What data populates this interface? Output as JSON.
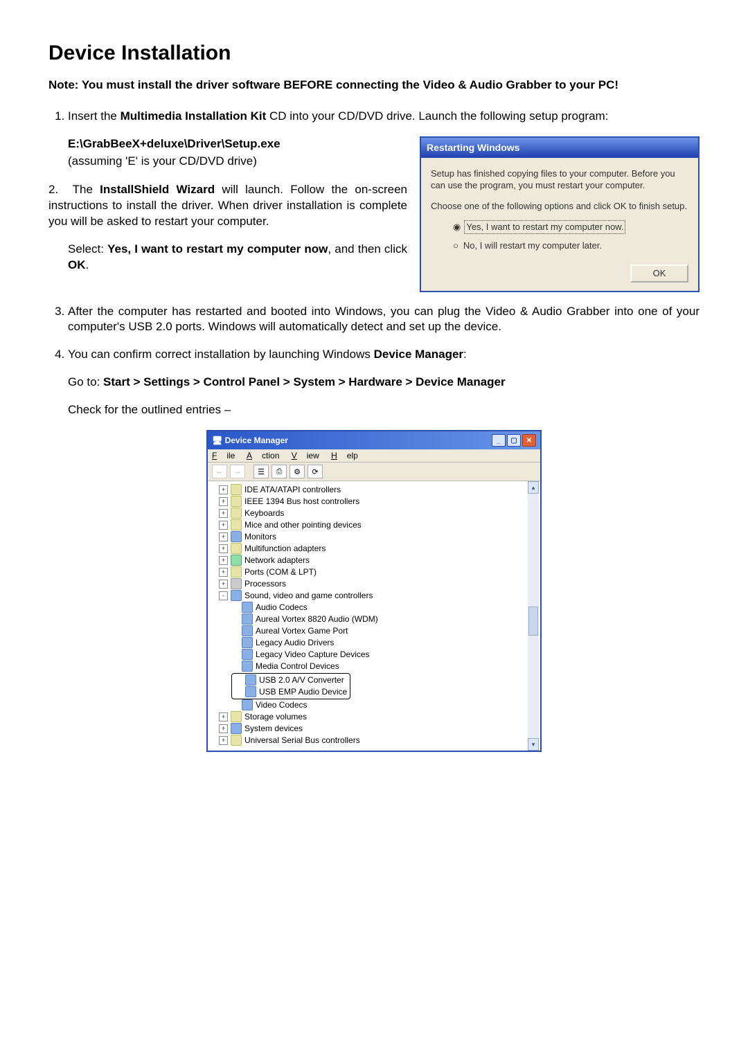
{
  "title": "Device Installation",
  "note_prefix": "Note: You must install the driver software BEFORE connecting the Video & Audio Grabber to your PC!",
  "step1_a": "Insert the ",
  "step1_bold": "Multimedia Installation Kit",
  "step1_b": " CD into your CD/DVD drive. Launch the following setup program:",
  "step1_path": "E:\\GrabBeeX+deluxe\\Driver\\Setup.exe",
  "step1_note": "(assuming 'E' is your CD/DVD drive)",
  "step2_a": "The ",
  "step2_bold": "InstallShield Wizard",
  "step2_b": " will launch. Follow the on-screen instructions to install the driver. When driver installation is complete you will be asked to restart your computer.",
  "step2_sel_a": "Select: ",
  "step2_sel_bold1": "Yes, I want to restart my computer now",
  "step2_sel_b": ", and then click ",
  "step2_sel_bold2": "OK",
  "step2_sel_c": ".",
  "dialog": {
    "title": "Restarting Windows",
    "p1": "Setup has finished copying files to your computer.  Before you can use the program, you must restart your computer.",
    "p2": "Choose one of the following options and click OK to finish setup.",
    "r1": "Yes, I want to restart my computer now.",
    "r2": "No, I will restart my computer later.",
    "ok": "OK"
  },
  "step3": "After the computer has restarted and booted into Windows, you can plug the Video & Audio Grabber into one of your computer's USB 2.0 ports. Windows will automatically detect and set up the device.",
  "step4_a": "You can confirm correct installation by launching Windows ",
  "step4_bold": "Device Manager",
  "step4_b": ":",
  "goto_a": "Go to: ",
  "goto_bold": "Start > Settings > Control Panel > System > Hardware > Device Manager",
  "check": "Check for the outlined entries –",
  "devmgr": {
    "title": "Device Manager",
    "menus": {
      "file": "File",
      "action": "Action",
      "view": "View",
      "help": "Help"
    },
    "tree": [
      {
        "lvl": 1,
        "pm": "+",
        "cls": "ic",
        "label": "IDE ATA/ATAPI controllers"
      },
      {
        "lvl": 1,
        "pm": "+",
        "cls": "ic",
        "label": "IEEE 1394 Bus host controllers"
      },
      {
        "lvl": 1,
        "pm": "+",
        "cls": "ic",
        "label": "Keyboards"
      },
      {
        "lvl": 1,
        "pm": "+",
        "cls": "ic",
        "label": "Mice and other pointing devices"
      },
      {
        "lvl": 1,
        "pm": "+",
        "cls": "ic-blue",
        "label": "Monitors"
      },
      {
        "lvl": 1,
        "pm": "+",
        "cls": "ic",
        "label": "Multifunction adapters"
      },
      {
        "lvl": 1,
        "pm": "+",
        "cls": "ic-green",
        "label": "Network adapters"
      },
      {
        "lvl": 1,
        "pm": "+",
        "cls": "ic",
        "label": "Ports (COM & LPT)"
      },
      {
        "lvl": 1,
        "pm": "+",
        "cls": "ic-gray",
        "label": "Processors"
      },
      {
        "lvl": 1,
        "pm": "-",
        "cls": "ic-blue",
        "label": "Sound, video and game controllers"
      },
      {
        "lvl": 2,
        "pm": "",
        "cls": "ic-blue",
        "label": "Audio Codecs"
      },
      {
        "lvl": 2,
        "pm": "",
        "cls": "ic-blue",
        "label": "Aureal Vortex 8820 Audio (WDM)"
      },
      {
        "lvl": 2,
        "pm": "",
        "cls": "ic-blue",
        "label": "Aureal Vortex Game Port"
      },
      {
        "lvl": 2,
        "pm": "",
        "cls": "ic-blue",
        "label": "Legacy Audio Drivers"
      },
      {
        "lvl": 2,
        "pm": "",
        "cls": "ic-blue",
        "label": "Legacy Video Capture Devices"
      },
      {
        "lvl": 2,
        "pm": "",
        "cls": "ic-blue",
        "label": "Media Control Devices"
      },
      {
        "lvl": 2,
        "pm": "",
        "cls": "ic-blue",
        "label": "USB 2.0 A/V Converter",
        "hl": true
      },
      {
        "lvl": 2,
        "pm": "",
        "cls": "ic-blue",
        "label": "USB EMP Audio Device",
        "hl": true
      },
      {
        "lvl": 2,
        "pm": "",
        "cls": "ic-blue",
        "label": "Video Codecs"
      },
      {
        "lvl": 1,
        "pm": "+",
        "cls": "ic",
        "label": "Storage volumes"
      },
      {
        "lvl": 1,
        "pm": "+",
        "cls": "ic-blue",
        "label": "System devices"
      },
      {
        "lvl": 1,
        "pm": "+",
        "cls": "ic",
        "label": "Universal Serial Bus controllers"
      }
    ]
  }
}
